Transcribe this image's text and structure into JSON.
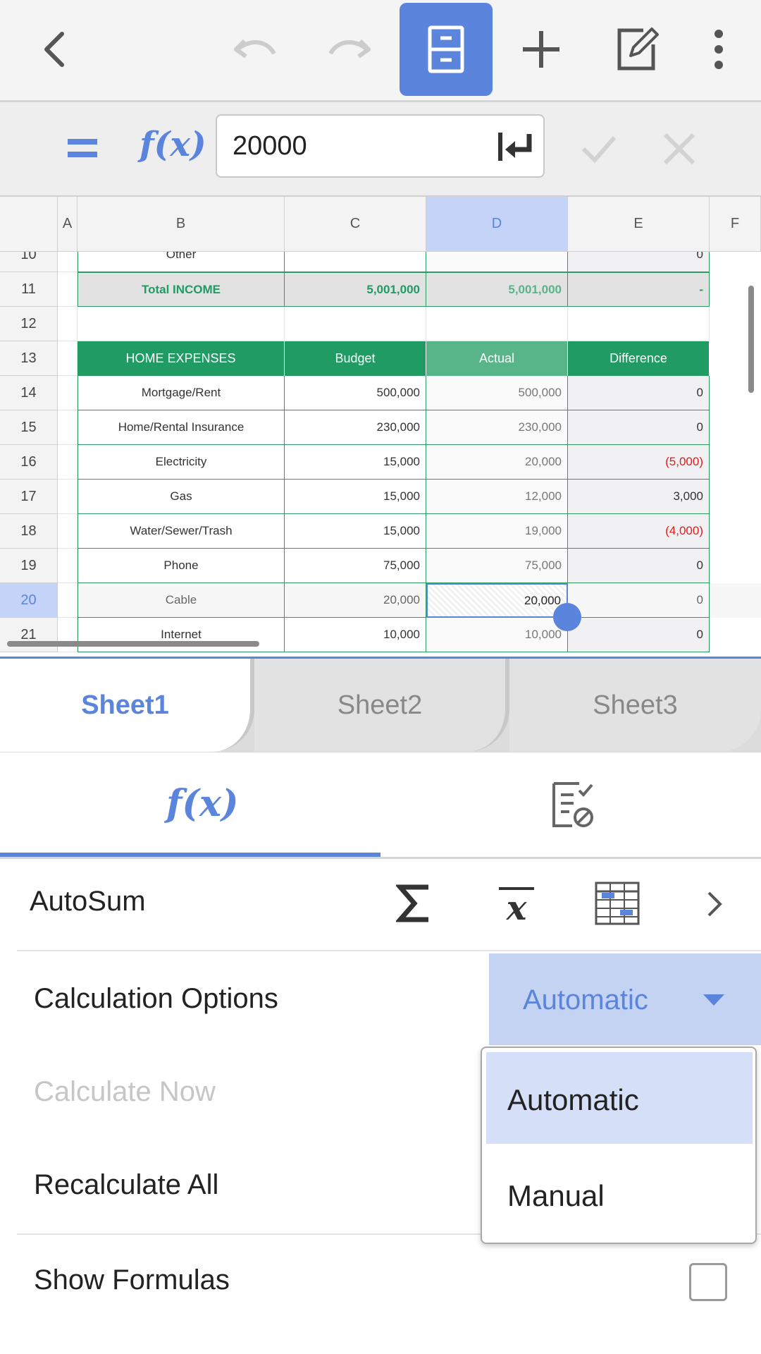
{
  "formula": {
    "value": "20000"
  },
  "columns": [
    "A",
    "B",
    "C",
    "D",
    "E",
    "F"
  ],
  "rows": [
    {
      "num": "10",
      "b": "Other",
      "c": "",
      "d": "",
      "e": "0",
      "style": "partial"
    },
    {
      "num": "11",
      "b": "Total INCOME",
      "c": "5,001,000",
      "d": "5,001,000",
      "e": "-",
      "style": "total"
    },
    {
      "num": "12",
      "b": "",
      "c": "",
      "d": "",
      "e": "",
      "style": "blank"
    },
    {
      "num": "13",
      "b": "HOME EXPENSES",
      "c": "Budget",
      "d": "Actual",
      "e": "Difference",
      "style": "header"
    },
    {
      "num": "14",
      "b": "Mortgage/Rent",
      "c": "500,000",
      "d": "500,000",
      "e": "0",
      "style": "data"
    },
    {
      "num": "15",
      "b": "Home/Rental Insurance",
      "c": "230,000",
      "d": "230,000",
      "e": "0",
      "style": "data"
    },
    {
      "num": "16",
      "b": "Electricity",
      "c": "15,000",
      "d": "20,000",
      "e": "(5,000)",
      "style": "data",
      "neg": true
    },
    {
      "num": "17",
      "b": "Gas",
      "c": "15,000",
      "d": "12,000",
      "e": "3,000",
      "style": "data"
    },
    {
      "num": "18",
      "b": "Water/Sewer/Trash",
      "c": "15,000",
      "d": "19,000",
      "e": "(4,000)",
      "style": "data",
      "neg": true
    },
    {
      "num": "19",
      "b": "Phone",
      "c": "75,000",
      "d": "75,000",
      "e": "0",
      "style": "data"
    },
    {
      "num": "20",
      "b": "Cable",
      "c": "20,000",
      "d": "20,000",
      "e": "0",
      "style": "data",
      "selected": true
    },
    {
      "num": "21",
      "b": "Internet",
      "c": "10,000",
      "d": "10,000",
      "e": "0",
      "style": "data"
    }
  ],
  "sheets": [
    "Sheet1",
    "Sheet2",
    "Sheet3"
  ],
  "panel": {
    "autosum_label": "AutoSum",
    "calc_options_label": "Calculation Options",
    "calc_options_value": "Automatic",
    "calc_now_label": "Calculate Now",
    "recalc_all_label": "Recalculate All",
    "show_formulas_label": "Show Formulas",
    "dropdown_options": [
      "Automatic",
      "Manual"
    ]
  },
  "icons": {
    "back": "chevron-left-icon",
    "undo": "undo-icon",
    "redo": "redo-icon",
    "file": "file-cabinet-icon",
    "add": "plus-icon",
    "edit": "edit-icon",
    "more": "more-vertical-icon",
    "fx": "fx-icon",
    "enter": "enter-icon",
    "confirm": "check-icon",
    "cancel": "close-icon",
    "review": "review-icon",
    "sum": "sigma-icon",
    "average": "average-icon",
    "table": "table-icon",
    "next": "chevron-right-icon",
    "dropdown": "caret-down-icon"
  },
  "colors": {
    "accent": "#5b84dd",
    "header_green": "#1f9b63",
    "actual_green": "#58b489",
    "negative": "#e01b1b",
    "grid_green": "#2e9c62"
  },
  "formula_fx": "f(x)"
}
